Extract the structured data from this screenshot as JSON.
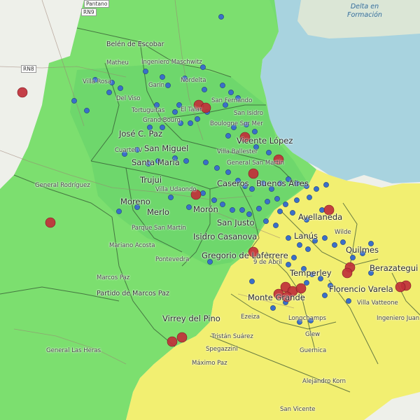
{
  "map": {
    "water_label": "Delta en Formación",
    "road_labels": [
      {
        "id": "rn8",
        "text": "RN8"
      },
      {
        "id": "rn9",
        "text": "RN9"
      },
      {
        "id": "pantano",
        "text": "Pantano"
      }
    ],
    "place_labels": [
      {
        "id": "belen-de-escobar",
        "text": "Belén de Escobar",
        "size": "mid"
      },
      {
        "id": "matheu",
        "text": "Matheu",
        "size": "sm"
      },
      {
        "id": "ingeniero-maschwitz",
        "text": "Ingeniero Maschwitz",
        "size": "sm"
      },
      {
        "id": "villa-rosa",
        "text": "Villa Rosa",
        "size": "sm"
      },
      {
        "id": "garin",
        "text": "Garín",
        "size": "sm"
      },
      {
        "id": "nordelta",
        "text": "Nordelta",
        "size": "sm"
      },
      {
        "id": "del-viso",
        "text": "Del Viso",
        "size": "sm"
      },
      {
        "id": "tortuguitas",
        "text": "Tortuguitas",
        "size": "sm"
      },
      {
        "id": "el-talar",
        "text": "El Talar",
        "size": "sm"
      },
      {
        "id": "san-fernando",
        "text": "San Fernando",
        "size": "sm"
      },
      {
        "id": "grand-bourg",
        "text": "Grand Bourg",
        "size": "sm"
      },
      {
        "id": "boulogne-sur-mer",
        "text": "Boulogne Sur Mer",
        "size": "sm"
      },
      {
        "id": "san-isidro",
        "text": "San Isidro",
        "size": "sm"
      },
      {
        "id": "jose-c-paz",
        "text": "José C. Paz",
        "size": "big"
      },
      {
        "id": "vicente-lopez",
        "text": "Vicente López",
        "size": "big"
      },
      {
        "id": "cuartel-v",
        "text": "Cuartel V",
        "size": "sm"
      },
      {
        "id": "san-miguel",
        "text": "San Miguel",
        "size": "big"
      },
      {
        "id": "villa-ballester",
        "text": "Villa Ballester",
        "size": "sm"
      },
      {
        "id": "santa-maria",
        "text": "Santa María",
        "size": "big"
      },
      {
        "id": "general-san-martin",
        "text": "General San Martín",
        "size": "sm"
      },
      {
        "id": "trujui",
        "text": "Trujui",
        "size": "big"
      },
      {
        "id": "caseros",
        "text": "Caseros",
        "size": "big"
      },
      {
        "id": "buenos-aires",
        "text": "Buenos Aires",
        "size": "big"
      },
      {
        "id": "general-rodriguez",
        "text": "General Rodríguez",
        "size": "sm"
      },
      {
        "id": "villa-udaondo",
        "text": "Villa Udaondo",
        "size": "sm"
      },
      {
        "id": "moreno",
        "text": "Moreno",
        "size": "big"
      },
      {
        "id": "moron",
        "text": "Morón",
        "size": "big"
      },
      {
        "id": "avellaneda",
        "text": "Avellaneda",
        "size": "big"
      },
      {
        "id": "merlo",
        "text": "Merlo",
        "size": "big"
      },
      {
        "id": "san-justo",
        "text": "San Justo",
        "size": "big"
      },
      {
        "id": "parque-san-martin",
        "text": "Parque San Martín",
        "size": "sm"
      },
      {
        "id": "wilde",
        "text": "Wilde",
        "size": "sm"
      },
      {
        "id": "lanus",
        "text": "Lanús",
        "size": "big"
      },
      {
        "id": "mariano-acosta",
        "text": "Mariano Acosta",
        "size": "sm"
      },
      {
        "id": "isidro-casanova",
        "text": "Isidro Casanova",
        "size": "big"
      },
      {
        "id": "quilmes",
        "text": "Quilmes",
        "size": "big"
      },
      {
        "id": "pontevedra",
        "text": "Pontevedra",
        "size": "sm"
      },
      {
        "id": "gregorio-de-laferrere",
        "text": "Gregorio de Laferrere",
        "size": "big"
      },
      {
        "id": "9-de-abril",
        "text": "9 de Abril",
        "size": "sm"
      },
      {
        "id": "berazategui",
        "text": "Berazategui",
        "size": "big"
      },
      {
        "id": "marcos-paz",
        "text": "Marcos Paz",
        "size": "sm"
      },
      {
        "id": "temperley",
        "text": "Temperley",
        "size": "big"
      },
      {
        "id": "partido-de-marcos-paz",
        "text": "Partido de Marcos Paz",
        "size": "mid"
      },
      {
        "id": "florencio-varela",
        "text": "Florencio Varela",
        "size": "big"
      },
      {
        "id": "monte-grande",
        "text": "Monte Grande",
        "size": "big"
      },
      {
        "id": "villa-vatteone",
        "text": "Villa Vatteone",
        "size": "sm"
      },
      {
        "id": "virrey-del-pino",
        "text": "Virrey del Pino",
        "size": "big"
      },
      {
        "id": "ezeiza",
        "text": "Ezeiza",
        "size": "sm"
      },
      {
        "id": "longchamps",
        "text": "Longchamps",
        "size": "sm"
      },
      {
        "id": "ingeniero-juan-allan",
        "text": "Ingeniero Juan Allan",
        "size": "sm"
      },
      {
        "id": "glew",
        "text": "Glew",
        "size": "sm"
      },
      {
        "id": "general-las-heras",
        "text": "General Las Heras",
        "size": "sm"
      },
      {
        "id": "tristan-suarez",
        "text": "Tristán Suárez",
        "size": "sm"
      },
      {
        "id": "guernica",
        "text": "Guernica",
        "size": "sm"
      },
      {
        "id": "spegazzini",
        "text": "Spegazzini",
        "size": "sm"
      },
      {
        "id": "maximo-paz",
        "text": "Máximo Paz",
        "size": "sm"
      },
      {
        "id": "alejandro-korn",
        "text": "Alejandro Korn",
        "size": "sm"
      },
      {
        "id": "san-vicente",
        "text": "San Vicente",
        "size": "sm"
      }
    ],
    "colors": {
      "green_zone": "#6fdd62",
      "yellow_zone": "#f1ee6a",
      "water": "#a8d3df",
      "land": "#eef0ea",
      "blue_marker": "#3a6fc9",
      "red_marker": "#c0303a"
    }
  }
}
